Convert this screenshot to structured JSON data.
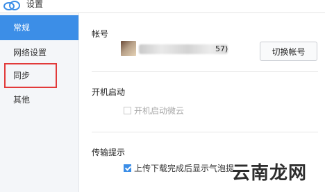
{
  "window": {
    "title": "设置"
  },
  "sidebar": {
    "items": [
      {
        "label": "常规",
        "active": true
      },
      {
        "label": "网络设置",
        "active": false
      },
      {
        "label": "同步",
        "active": false
      },
      {
        "label": "其他",
        "active": false
      }
    ]
  },
  "account": {
    "section_title": "帐号",
    "name_suffix": "57)",
    "switch_button_label": "切换帐号"
  },
  "startup": {
    "section_title": "开机启动",
    "option_label": "开机启动微云",
    "checked": false,
    "enabled": false
  },
  "transfer": {
    "section_title": "传输提示",
    "option_label": "上传下载完成后显示气泡提",
    "checked": true
  },
  "watermark": {
    "text": "云南龙网"
  },
  "colors": {
    "accent": "#3c8ee7",
    "highlight_border": "#e23a3a",
    "sidebar_bg": "#f4f6f9"
  }
}
